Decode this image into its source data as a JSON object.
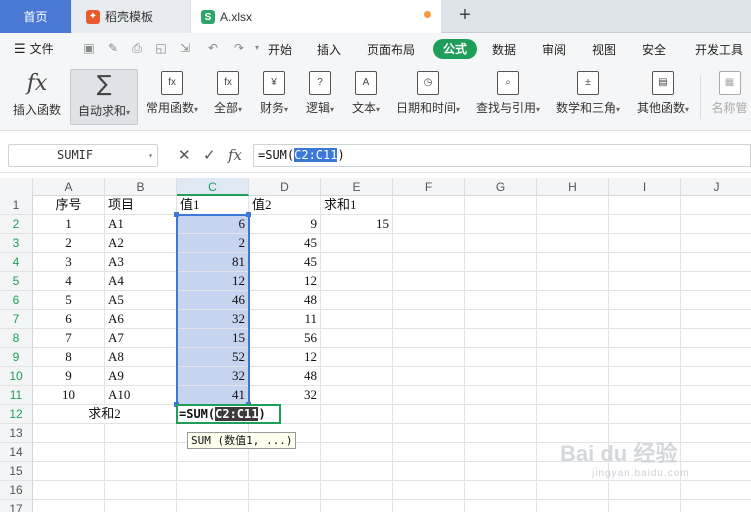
{
  "tabs": {
    "home": "首页",
    "template": "稻壳模板",
    "file": "A.xlsx",
    "new_tab": "+"
  },
  "menu": {
    "file": "文件",
    "items": [
      "开始",
      "插入",
      "页面布局",
      "公式",
      "数据",
      "审阅",
      "视图",
      "安全",
      "开发工具"
    ],
    "active": "公式"
  },
  "ribbon": {
    "insert_function": "插入函数",
    "autosum": "自动求和",
    "common_functions": "常用函数",
    "all": "全部",
    "finance": "财务",
    "logic": "逻辑",
    "text": "文本",
    "datetime": "日期和时间",
    "lookup": "查找与引用",
    "math": "数学和三角",
    "other": "其他函数",
    "name_manager": "名称管"
  },
  "formula_bar": {
    "name_box": "SUMIF",
    "formula_prefix": "=SUM(",
    "formula_ref": "C2:C11",
    "formula_suffix": ")",
    "fx": "fx"
  },
  "columns": [
    "A",
    "B",
    "C",
    "D",
    "E",
    "F",
    "G",
    "H",
    "I",
    "J"
  ],
  "rows": [
    "1",
    "2",
    "3",
    "4",
    "5",
    "6",
    "7",
    "8",
    "9",
    "10",
    "11",
    "12",
    "13",
    "14",
    "15",
    "16",
    "17"
  ],
  "sheet": {
    "headers": {
      "a": "序号",
      "b": "项目",
      "c": "值1",
      "d": "值2",
      "e": "求和1"
    },
    "data": [
      {
        "a": "1",
        "b": "A1",
        "c": "6",
        "d": "9"
      },
      {
        "a": "2",
        "b": "A2",
        "c": "2",
        "d": "45"
      },
      {
        "a": "3",
        "b": "A3",
        "c": "81",
        "d": "45"
      },
      {
        "a": "4",
        "b": "A4",
        "c": "12",
        "d": "12"
      },
      {
        "a": "5",
        "b": "A5",
        "c": "46",
        "d": "48"
      },
      {
        "a": "6",
        "b": "A6",
        "c": "32",
        "d": "11"
      },
      {
        "a": "7",
        "b": "A7",
        "c": "15",
        "d": "56"
      },
      {
        "a": "8",
        "b": "A8",
        "c": "52",
        "d": "12"
      },
      {
        "a": "9",
        "b": "A9",
        "c": "32",
        "d": "48"
      },
      {
        "a": "10",
        "b": "A10",
        "c": "41",
        "d": "32"
      }
    ],
    "e2": "15",
    "sum2_label": "求和2",
    "edit_prefix": "=SUM(",
    "edit_ref": "C2:C11",
    "edit_suffix": ")",
    "tooltip": "SUM (数值1, ...)"
  },
  "watermark": {
    "main": "Bai du 经验",
    "sub": "jingyan.baidu.com"
  },
  "colors": {
    "accent": "#1f9e5a",
    "selection": "#3b78d8",
    "tab_home": "#4a79d4"
  }
}
